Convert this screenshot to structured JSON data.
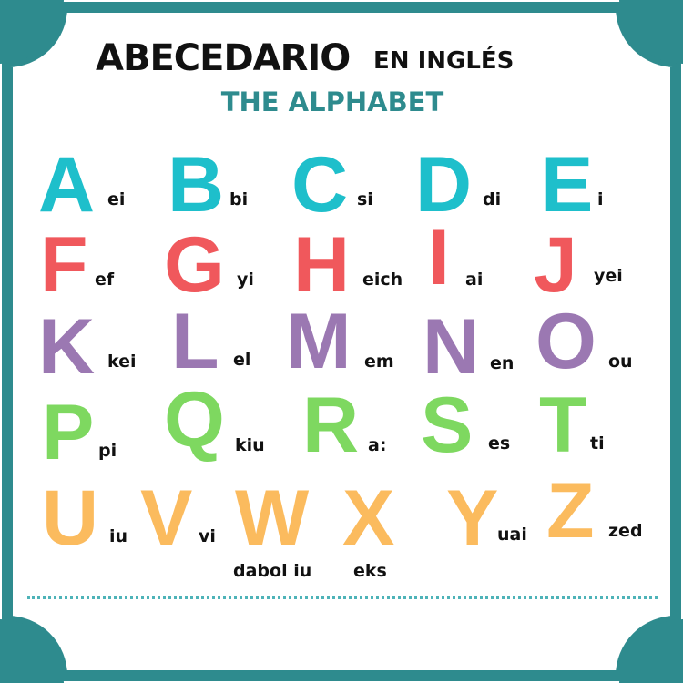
{
  "title": {
    "main": "ABECEDARIO",
    "side": "EN INGLÉS",
    "subtitle": "THE ALPHABET"
  },
  "colors": {
    "frame": "#2e8b8e",
    "row1": "#1ebfcb",
    "row2": "#f0585c",
    "row3": "#9b78b2",
    "row4": "#7ed860",
    "row5": "#fbbb5e"
  },
  "letters": [
    {
      "letter": "A",
      "pronunciation": "ei"
    },
    {
      "letter": "B",
      "pronunciation": "bi"
    },
    {
      "letter": "C",
      "pronunciation": "si"
    },
    {
      "letter": "D",
      "pronunciation": "di"
    },
    {
      "letter": "E",
      "pronunciation": "i"
    },
    {
      "letter": "F",
      "pronunciation": "ef"
    },
    {
      "letter": "G",
      "pronunciation": "yi"
    },
    {
      "letter": "H",
      "pronunciation": "eich"
    },
    {
      "letter": "I",
      "pronunciation": "ai"
    },
    {
      "letter": "J",
      "pronunciation": "yei"
    },
    {
      "letter": "K",
      "pronunciation": "kei"
    },
    {
      "letter": "L",
      "pronunciation": "el"
    },
    {
      "letter": "M",
      "pronunciation": "em"
    },
    {
      "letter": "N",
      "pronunciation": "en"
    },
    {
      "letter": "O",
      "pronunciation": "ou"
    },
    {
      "letter": "P",
      "pronunciation": "pi"
    },
    {
      "letter": "Q",
      "pronunciation": "kiu"
    },
    {
      "letter": "R",
      "pronunciation": "a:"
    },
    {
      "letter": "S",
      "pronunciation": "es"
    },
    {
      "letter": "T",
      "pronunciation": "ti"
    },
    {
      "letter": "U",
      "pronunciation": "iu"
    },
    {
      "letter": "V",
      "pronunciation": "vi"
    },
    {
      "letter": "W",
      "pronunciation": "dabol iu"
    },
    {
      "letter": "X",
      "pronunciation": "eks"
    },
    {
      "letter": "Y",
      "pronunciation": "uai"
    },
    {
      "letter": "Z",
      "pronunciation": "zed"
    }
  ]
}
